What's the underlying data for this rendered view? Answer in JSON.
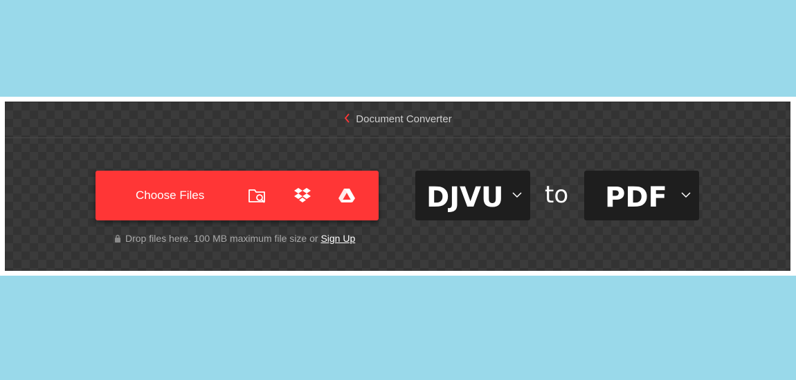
{
  "header": {
    "breadcrumb_label": "Document Converter"
  },
  "upload": {
    "choose_label": "Choose Files",
    "note_text": "Drop files here. 100 MB maximum file size or",
    "signup_label": "Sign Up",
    "sources": [
      "folder-search-icon",
      "dropbox-icon",
      "google-drive-icon"
    ]
  },
  "conversion": {
    "from_format": "DJVU",
    "to_label": "to",
    "to_format": "PDF"
  },
  "colors": {
    "accent": "#ff3636",
    "page_background": "#99d9ea",
    "panel_background": "#333333",
    "format_box": "#1e1e1e"
  }
}
